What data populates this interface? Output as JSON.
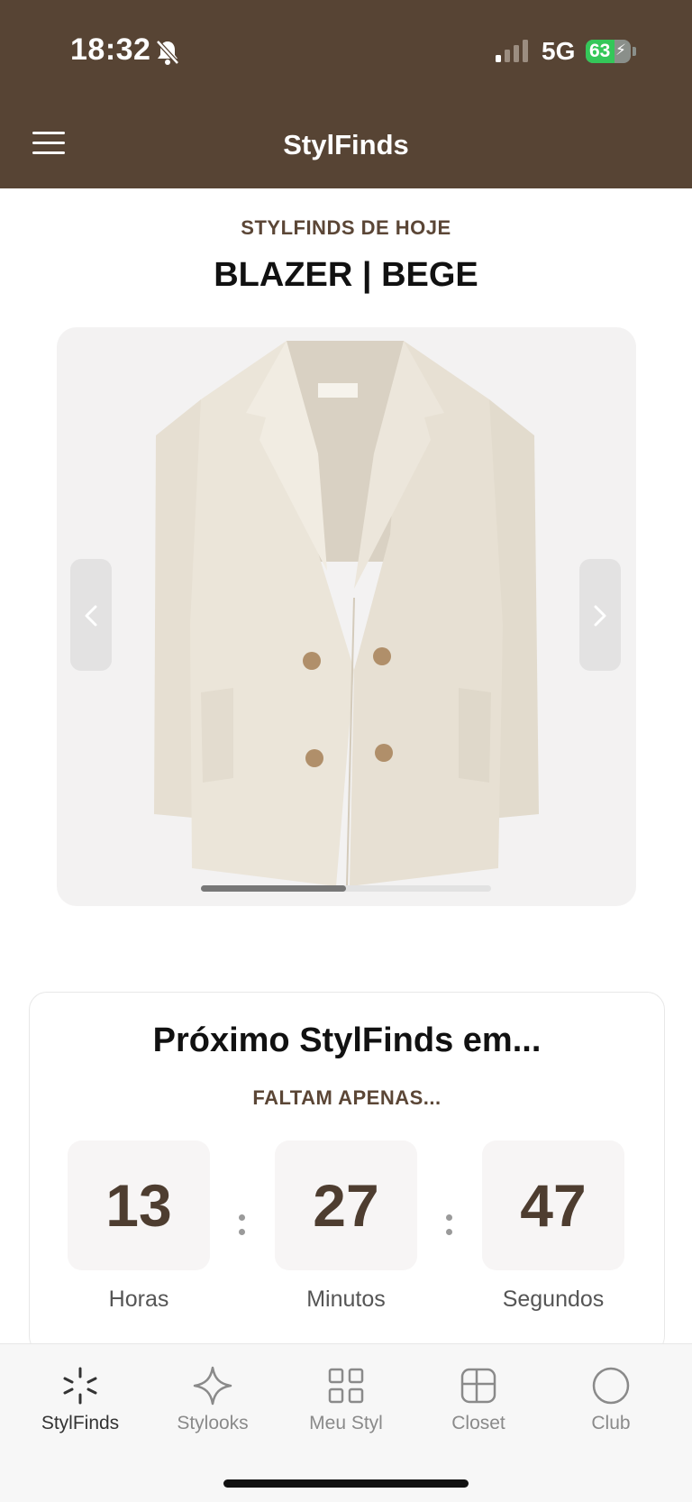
{
  "status_bar": {
    "time": "18:32",
    "network": "5G",
    "battery": "63",
    "battery_level": 0.63
  },
  "header": {
    "title": "StylFinds",
    "menu_icon": "hamburger-menu-icon"
  },
  "featured": {
    "eyebrow": "STYLFINDS DE HOJE",
    "product_name": "BLAZER | BEGE",
    "image_icon": "beige-blazer-image",
    "carousel_progress": 0.5
  },
  "countdown": {
    "title": "Próximo StylFinds em...",
    "subtitle": "FALTAM APENAS...",
    "units": [
      {
        "value": "13",
        "label": "Horas"
      },
      {
        "value": "27",
        "label": "Minutos"
      },
      {
        "value": "47",
        "label": "Segundos"
      }
    ]
  },
  "tabs": [
    {
      "label": "StylFinds",
      "icon": "sparkle-burst-icon",
      "active": true
    },
    {
      "label": "Stylooks",
      "icon": "star-outline-icon",
      "active": false
    },
    {
      "label": "Meu Styl",
      "icon": "grid-icon",
      "active": false
    },
    {
      "label": "Closet",
      "icon": "closet-icon",
      "active": false
    },
    {
      "label": "Club",
      "icon": "circle-icon",
      "active": false
    }
  ]
}
